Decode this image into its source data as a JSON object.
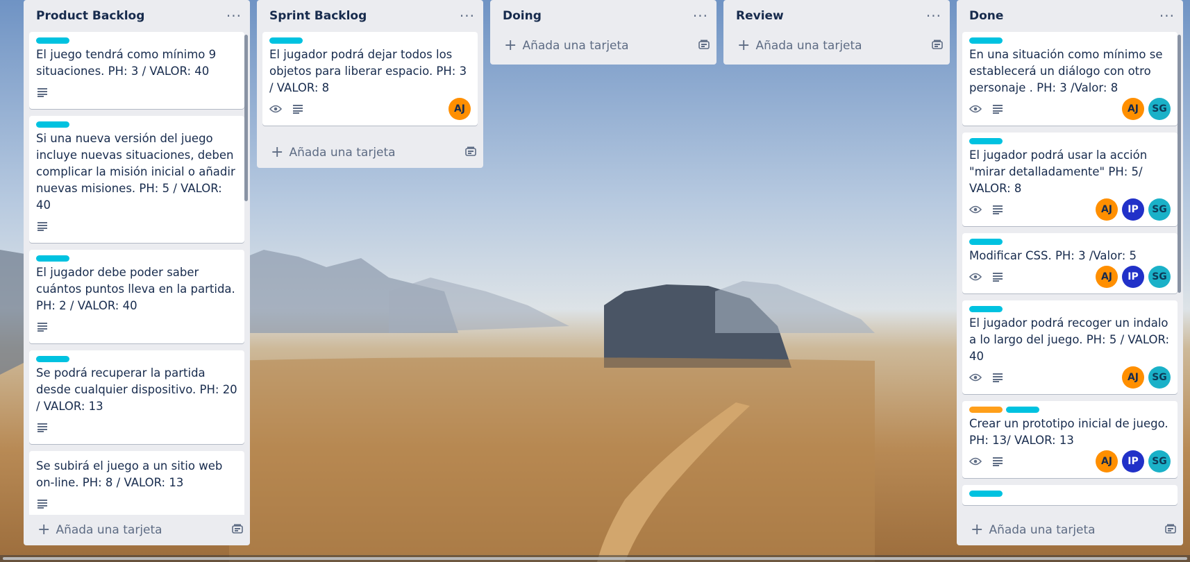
{
  "lists": [
    {
      "title": "Product Backlog",
      "cards": [
        {
          "labels": [
            "cyan"
          ],
          "text": "El juego tendrá como mínimo 9 situaciones. PH: 3 / VALOR: 40",
          "watch": false,
          "desc": true,
          "members": []
        },
        {
          "labels": [
            "cyan"
          ],
          "text": "Si una nueva versión del juego incluye nuevas situaciones, deben complicar la misión inicial o añadir nuevas misiones. PH: 5 / VALOR: 40",
          "watch": false,
          "desc": true,
          "members": []
        },
        {
          "labels": [
            "cyan"
          ],
          "text": "El jugador debe poder saber cuántos puntos lleva en la partida. PH: 2 / VALOR: 40",
          "watch": false,
          "desc": true,
          "members": []
        },
        {
          "labels": [
            "cyan"
          ],
          "text": "Se podrá recuperar la partida desde cualquier dispositivo. PH: 20 / VALOR: 13",
          "watch": false,
          "desc": true,
          "members": []
        },
        {
          "labels": [],
          "text": "Se subirá el juego a un sitio web on-line. PH: 8 / VALOR: 13",
          "watch": false,
          "desc": true,
          "members": []
        },
        {
          "labels": [
            "cyan"
          ],
          "text": "",
          "watch": false,
          "desc": false,
          "members": []
        }
      ],
      "add_label": "Añada una tarjeta"
    },
    {
      "title": "Sprint Backlog",
      "cards": [
        {
          "labels": [
            "cyan"
          ],
          "text": "El jugador podrá dejar todos los objetos para liberar espacio. PH: 3 / VALOR: 8",
          "watch": true,
          "desc": true,
          "members": [
            "AJ"
          ]
        }
      ],
      "add_label": "Añada una tarjeta"
    },
    {
      "title": "Doing",
      "cards": [],
      "add_label": "Añada una tarjeta"
    },
    {
      "title": "Review",
      "cards": [],
      "add_label": "Añada una tarjeta"
    },
    {
      "title": "Done",
      "cards": [
        {
          "labels": [
            "cyan"
          ],
          "text": "En una situación como mínimo se establecerá un diálogo con otro personaje . PH: 3 /Valor: 8",
          "watch": true,
          "desc": true,
          "members": [
            "AJ",
            "SG"
          ]
        },
        {
          "labels": [
            "cyan"
          ],
          "text": "El jugador podrá usar la acción \"mirar detalladamente\" PH: 5/ VALOR: 8",
          "watch": true,
          "desc": true,
          "members": [
            "AJ",
            "IP",
            "SG"
          ]
        },
        {
          "labels": [
            "cyan"
          ],
          "text": "Modificar CSS. PH: 3 /Valor: 5",
          "watch": true,
          "desc": true,
          "members": [
            "AJ",
            "IP",
            "SG"
          ]
        },
        {
          "labels": [
            "cyan"
          ],
          "text": "El jugador podrá recoger un indalo a lo largo del juego. PH: 5 / VALOR: 40",
          "watch": true,
          "desc": true,
          "members": [
            "AJ",
            "SG"
          ]
        },
        {
          "labels": [
            "orange",
            "cyan"
          ],
          "text": "Crear un prototipo inicial de juego. PH: 13/ VALOR: 13",
          "watch": true,
          "desc": true,
          "members": [
            "AJ",
            "IP",
            "SG"
          ]
        },
        {
          "labels": [
            "cyan"
          ],
          "text": "",
          "watch": false,
          "desc": false,
          "members": []
        }
      ],
      "add_label": "Añada una tarjeta"
    }
  ],
  "colors": {
    "label_cyan": "#00c2e0",
    "label_orange": "#ff9f1a",
    "avatar_AJ": "#ff8f00",
    "avatar_SG": "#1ab1c8",
    "avatar_IP": "#2131c8",
    "list_bg": "#ebecf0"
  },
  "icons": {
    "list_menu": "ellipsis-icon",
    "add": "plus-icon",
    "template": "card-template-icon",
    "watch": "eye-icon",
    "description": "description-icon"
  }
}
